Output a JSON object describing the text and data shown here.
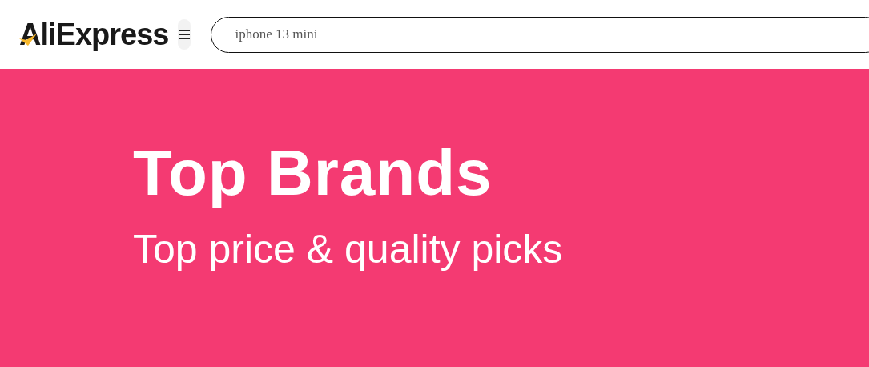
{
  "header": {
    "logo": "AliExpress",
    "search": {
      "value": "iphone 13 mini"
    }
  },
  "banner": {
    "title": "Top Brands",
    "subtitle": "Top price & quality picks"
  }
}
